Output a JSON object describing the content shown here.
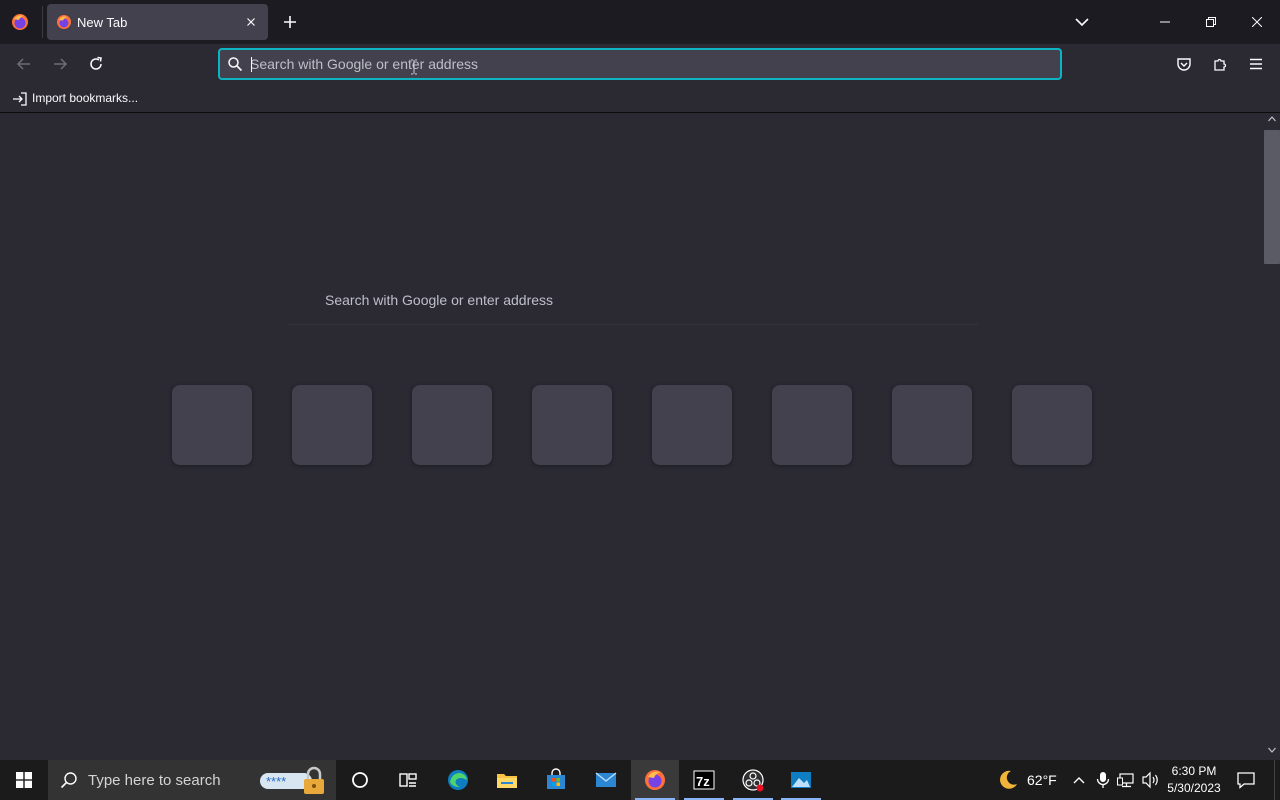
{
  "browser": {
    "tab": {
      "title": "New Tab"
    },
    "urlbar": {
      "placeholder": "Search with Google or enter address",
      "value": ""
    },
    "bookmarks_bar": {
      "import_label": "Import bookmarks..."
    }
  },
  "content": {
    "search_placeholder": "Search with Google or enter address",
    "top_sites_count": 8
  },
  "taskbar": {
    "search_placeholder": "Type here to search",
    "weather": {
      "temp": "62°F",
      "icon": "moon-icon"
    },
    "clock": {
      "time": "6:30 PM",
      "date": "5/30/2023"
    },
    "apps": [
      "task-view-icon",
      "edge-icon",
      "file-explorer-icon",
      "store-icon",
      "mail-icon",
      "firefox-icon",
      "7zip-icon",
      "obs-icon",
      "photos-icon"
    ]
  },
  "colors": {
    "accent": "#0db4c6",
    "toolbar_bg": "#2b2a33",
    "tabstrip_bg": "#1c1b22",
    "tile_bg": "#42414d"
  }
}
